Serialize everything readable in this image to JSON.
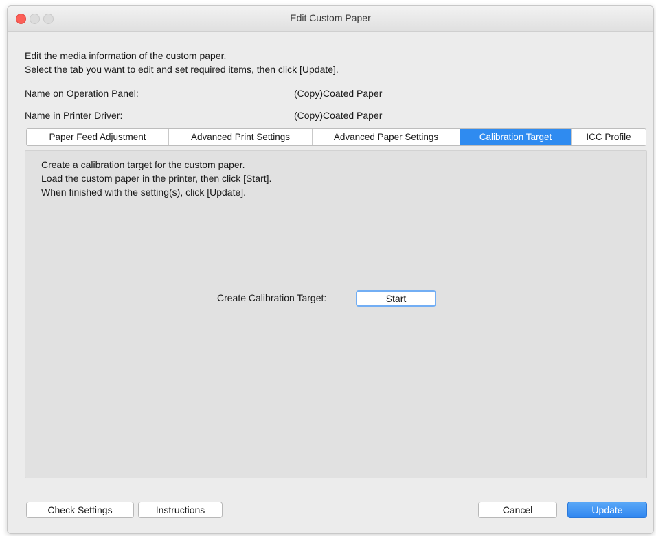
{
  "window": {
    "title": "Edit Custom Paper"
  },
  "intro": {
    "line1": "Edit the media information of the custom paper.",
    "line2": "Select the tab you want to edit and set required items, then click [Update]."
  },
  "info": {
    "operation_panel_label": "Name on Operation Panel:",
    "operation_panel_value": "(Copy)Coated Paper",
    "printer_driver_label": "Name in Printer Driver:",
    "printer_driver_value": "(Copy)Coated Paper"
  },
  "tabs": [
    {
      "label": "Paper Feed Adjustment",
      "active": false
    },
    {
      "label": "Advanced Print Settings",
      "active": false
    },
    {
      "label": "Advanced Paper Settings",
      "active": false
    },
    {
      "label": "Calibration Target",
      "active": true
    },
    {
      "label": "ICC Profile",
      "active": false
    }
  ],
  "panel": {
    "line1": "Create a calibration target for the custom paper.",
    "line2": "Load the custom paper in the printer, then click [Start].",
    "line3": "When finished with the setting(s), click [Update].",
    "calibration_label": "Create Calibration Target:",
    "start_label": "Start"
  },
  "footer": {
    "check_settings_label": "Check Settings",
    "instructions_label": "Instructions",
    "cancel_label": "Cancel",
    "update_label": "Update"
  },
  "colors": {
    "accent": "#2f8bf0",
    "close_button": "#fc5f57"
  }
}
